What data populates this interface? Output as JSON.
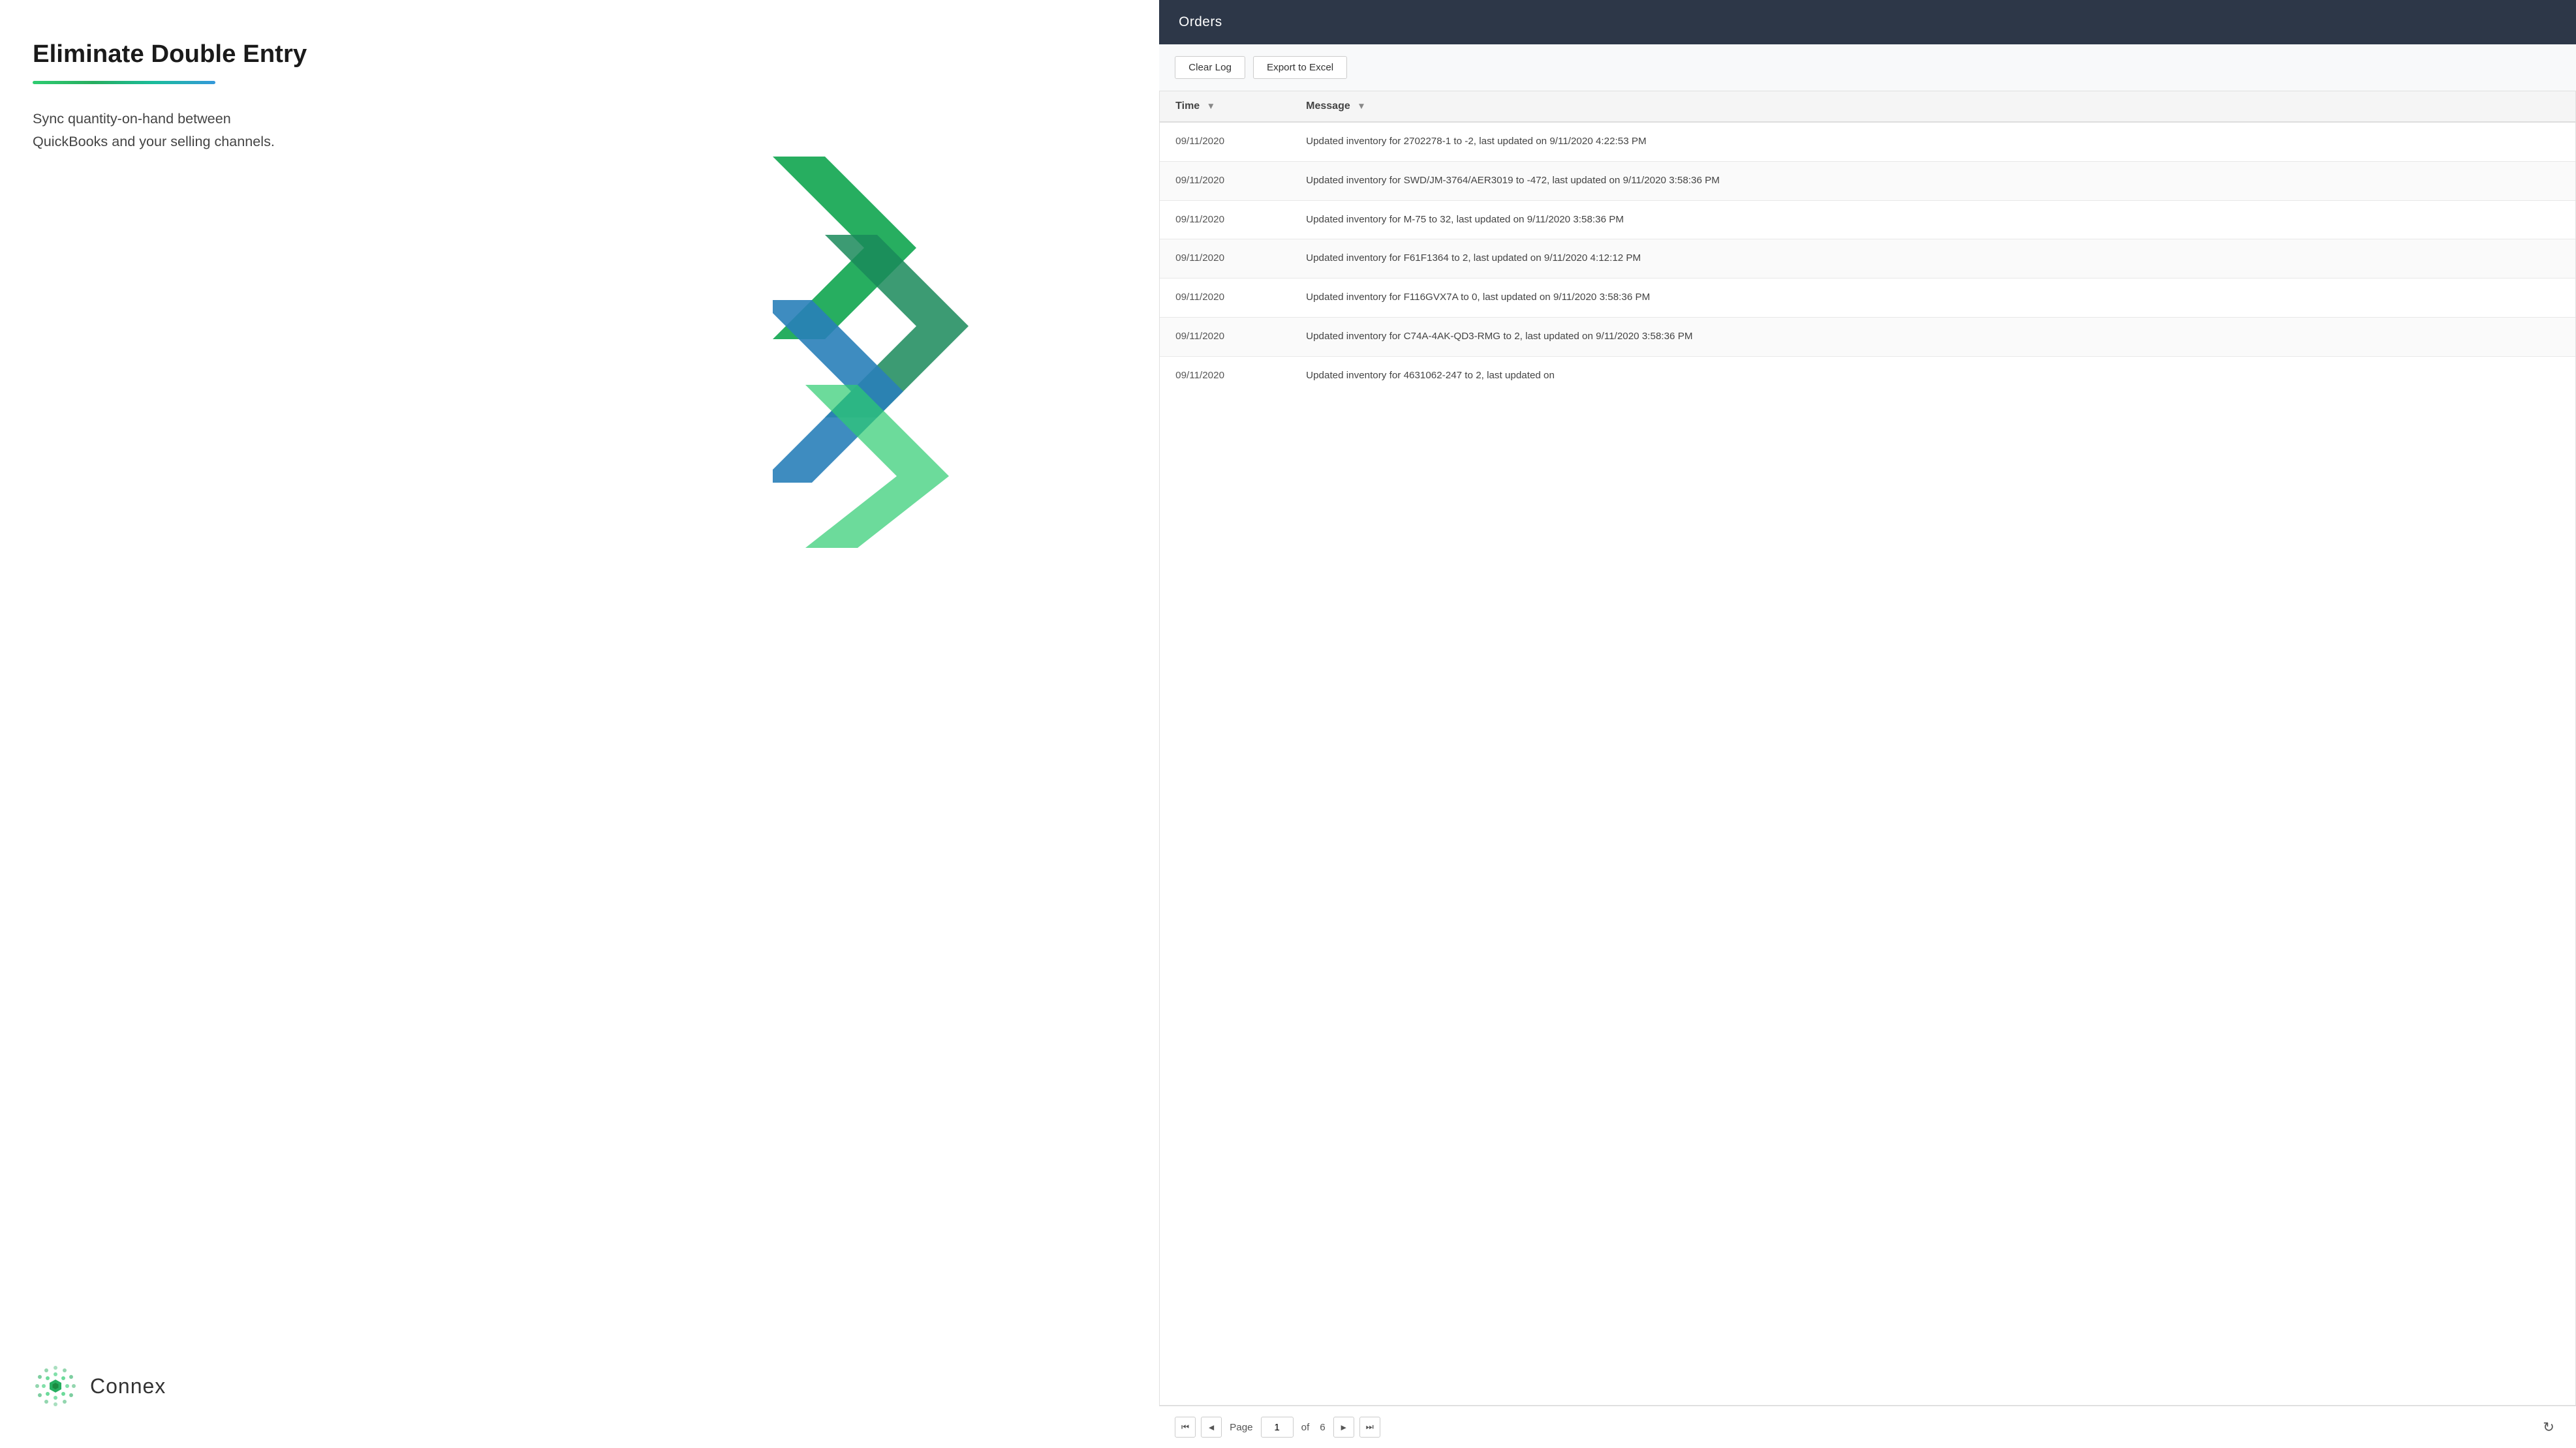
{
  "left": {
    "heading": "Eliminate Double Entry",
    "subtext": "Sync quantity-on-hand between QuickBooks and your selling channels.",
    "logo_text": "Connex",
    "underline_gradient": "linear-gradient(to right, #27ae60, #1abc9c, #3498db)"
  },
  "orders_panel": {
    "title": "Orders",
    "toolbar": {
      "clear_log_label": "Clear Log",
      "export_excel_label": "Export to Excel"
    },
    "table": {
      "columns": [
        {
          "key": "time",
          "label": "Time"
        },
        {
          "key": "message",
          "label": "Message"
        }
      ],
      "rows": [
        {
          "time": "09/11/2020",
          "message": "Updated inventory for 2702278-1 to -2, last updated on 9/11/2020 4:22:53 PM"
        },
        {
          "time": "09/11/2020",
          "message": "Updated inventory for SWD/JM-3764/AER3019 to -472, last updated on 9/11/2020 3:58:36 PM"
        },
        {
          "time": "09/11/2020",
          "message": "Updated inventory for M-75 to 32, last updated on 9/11/2020 3:58:36 PM"
        },
        {
          "time": "09/11/2020",
          "message": "Updated inventory for F61F1364 to 2, last updated on 9/11/2020 4:12:12 PM"
        },
        {
          "time": "09/11/2020",
          "message": "Updated inventory for F116GVX7A to 0, last updated on 9/11/2020 3:58:36 PM"
        },
        {
          "time": "09/11/2020",
          "message": "Updated inventory for C74A-4AK-QD3-RMG to 2, last updated on 9/11/2020 3:58:36 PM"
        },
        {
          "time": "09/11/2020",
          "message": "Updated inventory for 4631062-247 to 2, last updated on"
        }
      ]
    },
    "pagination": {
      "page_label": "Page",
      "current_page": "1",
      "of_label": "of",
      "total_pages": "6"
    }
  }
}
